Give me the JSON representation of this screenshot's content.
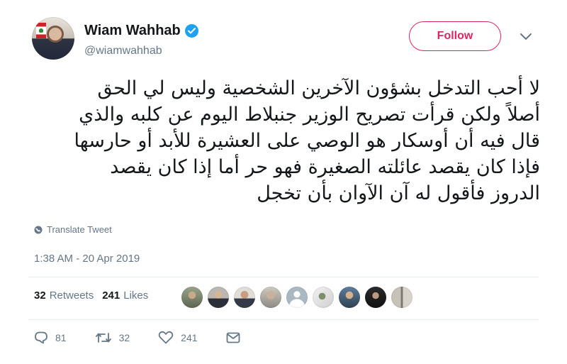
{
  "user": {
    "display_name": "Wiam Wahhab",
    "handle": "@wiamwahhab",
    "follow_label": "Follow"
  },
  "tweet": {
    "lines": [
      "لا أحب التدخل بشؤون الآخرين الشخصية وليس لي الحق",
      "أصلاً ولكن قرأت تصريح الوزير جنبلاط اليوم عن كلبه والذي",
      "قال فيه أن أوسكار هو الوصي على العشيرة للأبد أو حارسها",
      "فإذا كان يقصد عائلته الصغيرة فهو حر أما إذا كان يقصد",
      "الدروز فأقول له آن الآوان بأن تخجل"
    ],
    "translate_label": "Translate Tweet",
    "timestamp": "1:38 AM - 20 Apr 2019"
  },
  "stats": {
    "retweets_count": "32",
    "retweets_label": "Retweets",
    "likes_count": "241",
    "likes_label": "Likes"
  },
  "actions": {
    "reply_count": "81",
    "retweet_count": "32",
    "like_count": "241"
  },
  "colors": {
    "accent_follow": "#e0245e",
    "verified": "#1da1f2",
    "secondary_text": "#657786"
  }
}
